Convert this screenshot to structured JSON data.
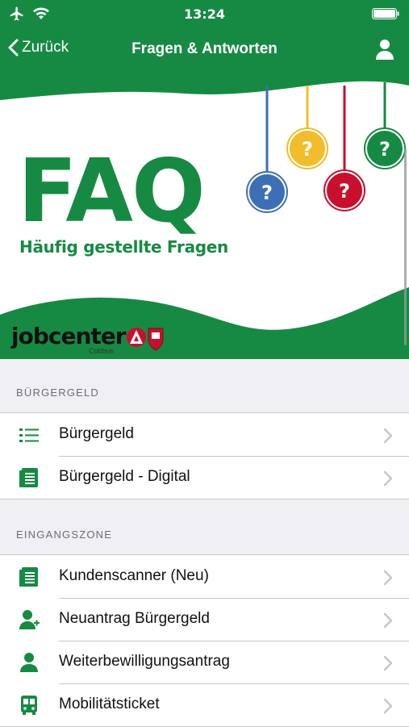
{
  "status_bar": {
    "time": "13:24"
  },
  "nav": {
    "back_label": "Zurück",
    "title": "Fragen & Antworten"
  },
  "banner": {
    "title": "FAQ",
    "subtitle": "Häufig gestellte Fragen",
    "logo_text": "jobcenter",
    "logo_city": "Cottbus"
  },
  "sections": [
    {
      "header": "BÜRGERGELD",
      "items": [
        {
          "label": "Bürgergeld",
          "icon": "list-icon"
        },
        {
          "label": "Bürgergeld - Digital",
          "icon": "document-icon"
        }
      ]
    },
    {
      "header": "EINGANGSZONE",
      "items": [
        {
          "label": "Kundenscanner (Neu)",
          "icon": "document-icon"
        },
        {
          "label": "Neuantrag Bürgergeld",
          "icon": "add-user-icon"
        },
        {
          "label": "Weiterbewilligungsantrag",
          "icon": "user-icon"
        },
        {
          "label": "Mobilitätsticket",
          "icon": "bus-icon"
        }
      ]
    }
  ],
  "colors": {
    "brand_green": "#168a43",
    "blue": "#3c6fb6",
    "yellow": "#f2bd2b",
    "red": "#c8102e"
  }
}
